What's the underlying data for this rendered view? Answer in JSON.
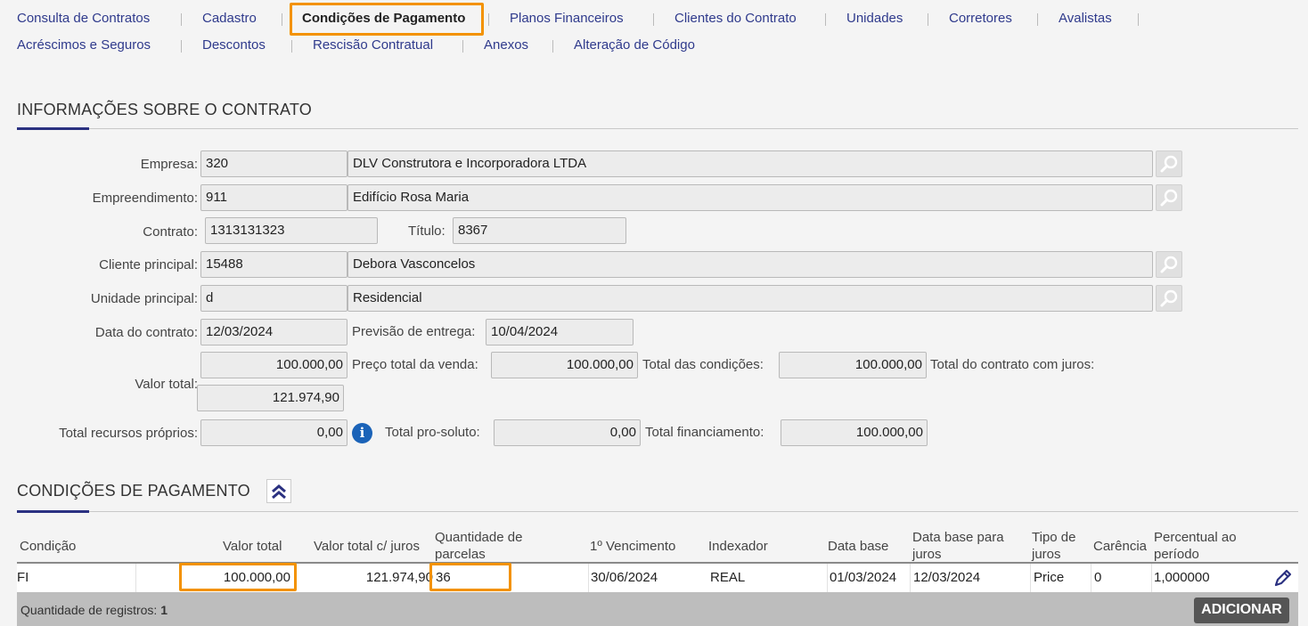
{
  "tabs": [
    {
      "label": "Consulta de Contratos"
    },
    {
      "label": "Cadastro"
    },
    {
      "label": "Condições de Pagamento"
    },
    {
      "label": "Planos Financeiros"
    },
    {
      "label": "Clientes do Contrato"
    },
    {
      "label": "Unidades"
    },
    {
      "label": "Corretores"
    },
    {
      "label": "Avalistas"
    },
    {
      "label": "Acréscimos e Seguros"
    },
    {
      "label": "Descontos"
    },
    {
      "label": "Rescisão Contratual"
    },
    {
      "label": "Anexos"
    },
    {
      "label": "Alteração de Código"
    }
  ],
  "active_tab": "Condições de Pagamento",
  "info_section": {
    "title": "INFORMAÇÕES SOBRE O CONTRATO",
    "empresa_label": "Empresa:",
    "empresa_code": "320",
    "empresa_name": "DLV Construtora e Incorporadora LTDA",
    "empreendimento_label": "Empreendimento:",
    "empreendimento_code": "911",
    "empreendimento_name": "Edifício Rosa Maria",
    "contrato_label": "Contrato:",
    "contrato_value": "1313131323",
    "titulo_label": "Título:",
    "titulo_value": "8367",
    "cliente_label": "Cliente principal:",
    "cliente_code": "15488",
    "cliente_name": "Debora Vasconcelos",
    "unidade_label": "Unidade principal:",
    "unidade_code": "d",
    "unidade_name": "Residencial",
    "data_contrato_label": "Data do contrato:",
    "data_contrato_value": "12/03/2024",
    "previsao_label": "Previsão de entrega:",
    "previsao_value": "10/04/2024",
    "valor_total_label": "Valor total:",
    "valor_total_value": "100.000,00",
    "preco_total_label": "Preço total da venda:",
    "preco_total_value": "100.000,00",
    "total_condicoes_label": "Total das condições:",
    "total_condicoes_value": "100.000,00",
    "total_juros_label": "Total do contrato com juros:",
    "total_juros_value": "121.974,90",
    "recursos_label": "Total recursos próprios:",
    "recursos_value": "0,00",
    "pro_soluto_label": "Total pro-soluto:",
    "pro_soluto_value": "0,00",
    "financiamento_label": "Total financiamento:",
    "financiamento_value": "100.000,00"
  },
  "payment_section": {
    "title": "CONDIÇÕES DE PAGAMENTO",
    "columns": {
      "condicao": "Condição",
      "valor_total": "Valor total",
      "valor_juros": "Valor total c/ juros",
      "qtd_parcelas": "Quantidade de parcelas",
      "vencimento": "1º Vencimento",
      "indexador": "Indexador",
      "data_base": "Data base",
      "data_base_juros": "Data base para juros",
      "tipo_juros": "Tipo de juros",
      "carencia": "Carência",
      "percentual": "Percentual ao período"
    },
    "rows": [
      {
        "condicao": "FI",
        "valor_total": "100.000,00",
        "valor_juros": "121.974,90",
        "qtd_parcelas": "36",
        "vencimento": "30/06/2024",
        "indexador": "REAL",
        "data_base": "01/03/2024",
        "data_base_juros": "12/03/2024",
        "tipo_juros": "Price",
        "carencia": "0",
        "percentual": "1,000000"
      }
    ],
    "footer_label": "Quantidade de registros:",
    "footer_count": "1",
    "add_button": "ADICIONAR"
  },
  "colors": {
    "accent": "#2b3181",
    "highlight": "#f39200",
    "link": "#2f3a8c"
  },
  "icons": [
    "search-icon",
    "info-icon",
    "double-chevron-up-icon",
    "pencil-icon"
  ]
}
